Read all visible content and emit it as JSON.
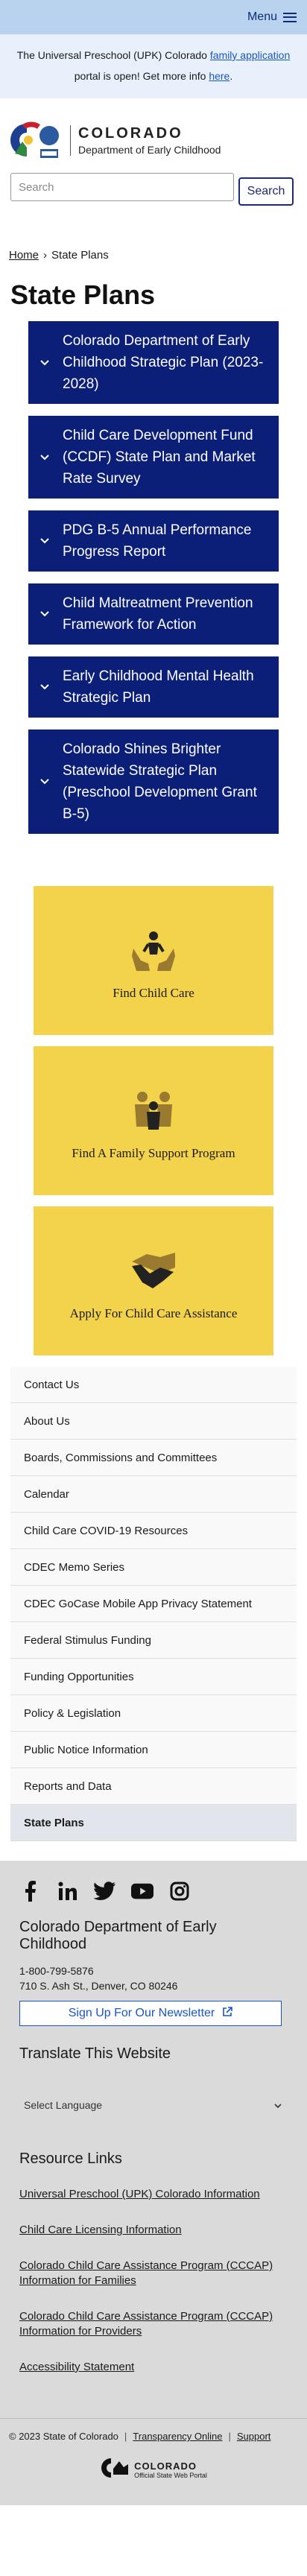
{
  "topbar": {
    "menu_label": "Menu"
  },
  "alert": {
    "text_before": "The Universal Preschool (UPK) Colorado ",
    "link": "family application",
    "text_after": " portal is open! Get more info ",
    "link2": "here",
    "end": "."
  },
  "header": {
    "logo_title": "COLORADO",
    "logo_subtitle": "Department of Early Childhood",
    "search_placeholder": "Search",
    "search_button": "Search"
  },
  "breadcrumb": {
    "home": "Home",
    "sep": "›",
    "current": "State Plans"
  },
  "page_title": "State Plans",
  "accordion": [
    "Colorado Department of Early Childhood Strategic Plan (2023-2028)",
    "Child Care Development Fund (CCDF) State Plan and Market Rate Survey",
    "PDG B-5 Annual Performance Progress Report",
    "Child Maltreatment Prevention Framework for Action",
    "Early Childhood Mental Health Strategic Plan",
    "Colorado Shines Brighter Statewide Strategic Plan (Preschool Development Grant B-5)"
  ],
  "cards": [
    {
      "label": "Find Child Care",
      "icon": "hands-child-icon"
    },
    {
      "label": "Find A Family Support Program",
      "icon": "family-icon"
    },
    {
      "label": "Apply For Child Care Assistance",
      "icon": "handshake-icon"
    }
  ],
  "sidenav": [
    "Contact Us",
    "About Us",
    "Boards, Commissions and Committees",
    "Calendar",
    "Child Care COVID-19 Resources",
    "CDEC Memo Series",
    "CDEC GoCase Mobile App Privacy Statement",
    "Federal Stimulus Funding",
    "Funding Opportunities",
    "Policy & Legislation",
    "Public Notice Information",
    "Reports and Data",
    "State Plans"
  ],
  "footer": {
    "org_name": "Colorado Department of Early Childhood",
    "phone": "1-800-799-5876",
    "address": "710 S. Ash St., Denver, CO 80246",
    "newsletter": "Sign Up For Our Newsletter",
    "translate_title": "Translate This Website",
    "language_select": "Select Language",
    "resource_title": "Resource Links",
    "resources": [
      "Universal Preschool (UPK) Colorado Information",
      "Child Care Licensing Information",
      "Colorado Child Care Assistance Program (CCCAP) Information for Families",
      "Colorado Child Care Assistance Program (CCCAP) Information for Providers",
      "Accessibility Statement"
    ]
  },
  "bottom": {
    "copyright": "© 2023 State of Colorado",
    "transparency": "Transparency Online",
    "support": "Support",
    "portal_title": "COLORADO",
    "portal_sub": "Official State Web Portal"
  },
  "colors": {
    "navy": "#0c1f78",
    "yellow": "#f4d34c",
    "topbar": "#b9d3ee",
    "alert_bg": "#e8f1fb",
    "footer_bg": "#dadada"
  }
}
